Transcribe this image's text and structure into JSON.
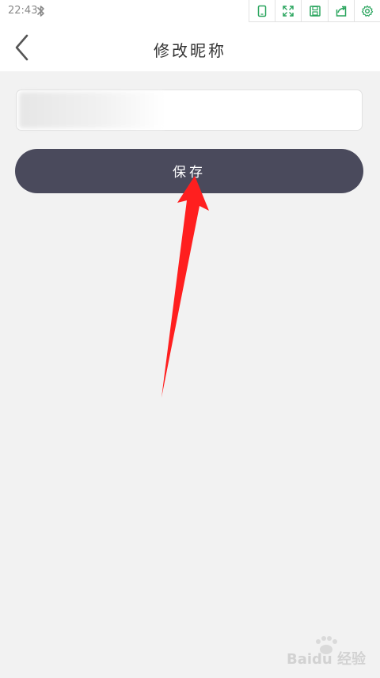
{
  "status_bar": {
    "time": "22:43",
    "bluetooth_icon": "bluetooth-icon"
  },
  "toolbar": {
    "icons": [
      "phone-icon",
      "expand-icon",
      "save-icon",
      "share-icon",
      "settings-icon"
    ],
    "accent_color": "#2aa55e"
  },
  "header": {
    "title": "修改昵称",
    "back_icon": "chevron-left-icon"
  },
  "nickname_input": {
    "value": ""
  },
  "save_button": {
    "label": "保存",
    "color": "#4a4a5c"
  },
  "annotation": {
    "arrow_color": "#ff1f1f"
  },
  "watermark": {
    "text": "Baidu 经验"
  }
}
